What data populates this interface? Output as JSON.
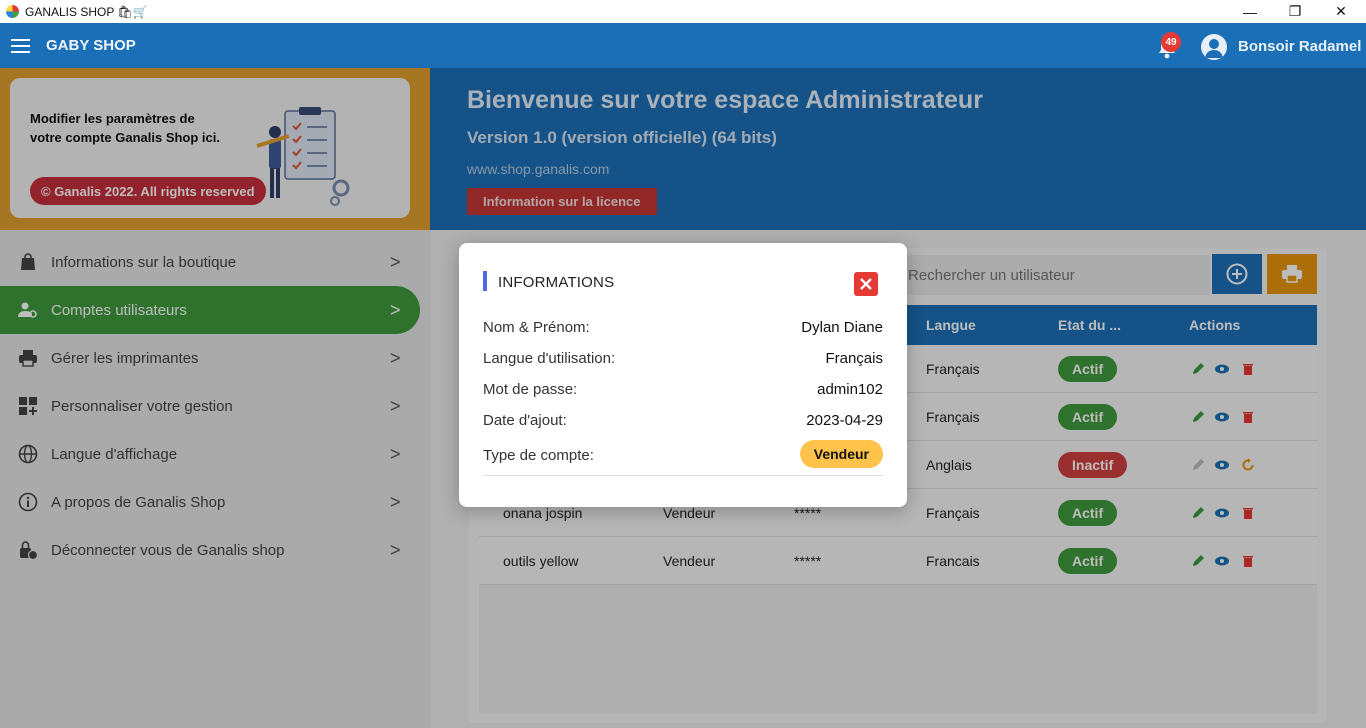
{
  "window": {
    "title": "GANALIS SHOP 🛍🛒",
    "min": "—",
    "restore": "❐",
    "close": "✕"
  },
  "appbar": {
    "shop_name": "GABY SHOP",
    "notif_count": "49",
    "greeting": "Bonsoir Radamel"
  },
  "promo": {
    "text": "Modifier les paramètres de votre compte Ganalis Shop ici.",
    "rights": "© Ganalis 2022. All rights reserved"
  },
  "sidebar": {
    "items": [
      {
        "label": "Informations sur la boutique",
        "icon": "shopping-bag-icon"
      },
      {
        "label": "Comptes utilisateurs",
        "icon": "user-gear-icon",
        "active": true
      },
      {
        "label": "Gérer les imprimantes",
        "icon": "printer-icon"
      },
      {
        "label": "Personnaliser votre gestion",
        "icon": "dashboard-add-icon"
      },
      {
        "label": "Langue d'affichage",
        "icon": "globe-icon"
      },
      {
        "label": "A propos de Ganalis Shop",
        "icon": "info-icon"
      },
      {
        "label": "Déconnecter vous de Ganalis shop",
        "icon": "lock-user-icon"
      }
    ],
    "chevron": ">"
  },
  "banner": {
    "title": "Bienvenue sur votre espace Administrateur",
    "version": "Version 1.0 (version officielle) (64 bits)",
    "site": "www.shop.ganalis.com",
    "license_btn": "Information sur la licence"
  },
  "users": {
    "search_placeholder": "Rechercher un utilisateur",
    "columns": {
      "langue": "Langue",
      "etat": "Etat du ...",
      "actions": "Actions"
    },
    "rows": [
      {
        "name": "",
        "type": "",
        "pwd": "",
        "langue": "Français",
        "etat": "Actif",
        "active": true
      },
      {
        "name": "",
        "type": "",
        "pwd": "",
        "langue": "Français",
        "etat": "Actif",
        "active": true
      },
      {
        "name": "",
        "type": "",
        "pwd": "",
        "langue": "Anglais",
        "etat": "Inactif",
        "active": false
      },
      {
        "name": "onana jospin",
        "type": "Vendeur",
        "pwd": "*****",
        "langue": "Français",
        "etat": "Actif",
        "active": true
      },
      {
        "name": "outils yellow",
        "type": "Vendeur",
        "pwd": "*****",
        "langue": "Francais",
        "etat": "Actif",
        "active": true
      }
    ]
  },
  "modal": {
    "title": "INFORMATIONS",
    "fields": [
      {
        "label": "Nom & Prénom:",
        "value": "Dylan Diane"
      },
      {
        "label": "Langue d'utilisation:",
        "value": "Français"
      },
      {
        "label": "Mot de passe:",
        "value": "admin102"
      },
      {
        "label": "Date d'ajout:",
        "value": "2023-04-29"
      }
    ],
    "type_label": "Type de compte:",
    "type_value": "Vendeur"
  },
  "colors": {
    "primary": "#1b6fb7",
    "success": "#3e9a3e",
    "danger": "#d04040",
    "warning": "#e8950d",
    "accent": "#4f6ae0"
  }
}
